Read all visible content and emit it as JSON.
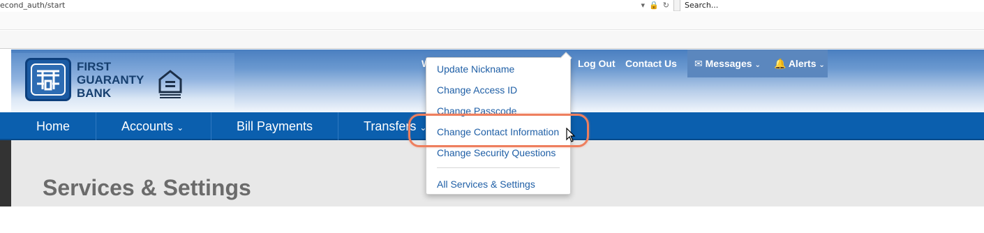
{
  "browser": {
    "url": "econd_auth/start",
    "search_placeholder": "Search..."
  },
  "brand": {
    "name_line1": "FIRST",
    "name_line2": "GUARANTY",
    "name_line3": "BANK"
  },
  "header_links": {
    "welcome": "W",
    "logout": "Log Out",
    "contact": "Contact Us",
    "messages": "Messages",
    "alerts": "Alerts"
  },
  "main_nav": {
    "home": "Home",
    "accounts": "Accounts",
    "bill_payments": "Bill Payments",
    "transfers": "Transfers"
  },
  "dropdown": {
    "items": [
      "Update Nickname",
      "Change Access ID",
      "Change Passcode",
      "Change Contact Information",
      "Change Security Questions",
      "All Services & Settings"
    ]
  },
  "page": {
    "title": "Services & Settings"
  },
  "colors": {
    "nav_blue": "#0b5fae",
    "link_blue": "#1f5fa6",
    "highlight": "#ee7f5e"
  },
  "icons": {
    "messages": "envelope-icon",
    "alerts": "bell-icon",
    "chevron": "chevron-down-icon",
    "cursor": "mouse-cursor-icon"
  }
}
